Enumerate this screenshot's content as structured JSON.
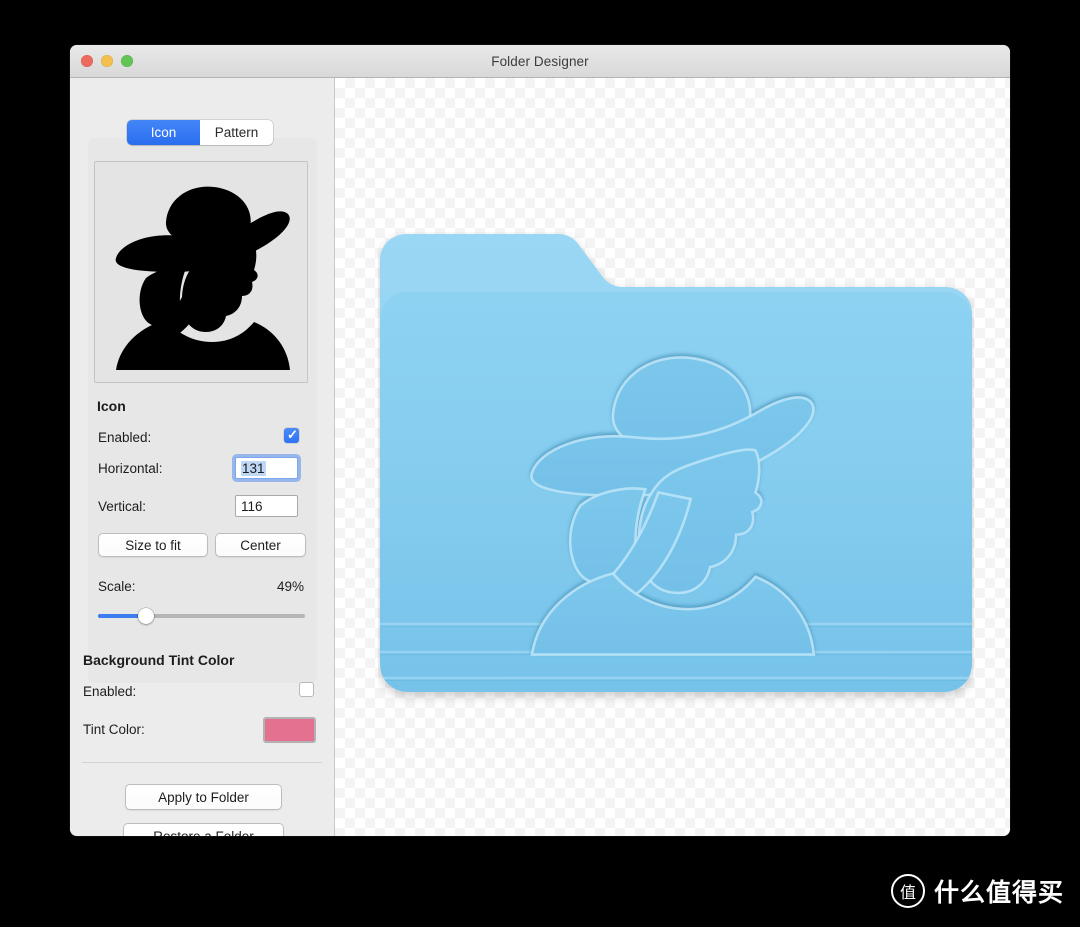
{
  "window": {
    "title": "Folder Designer",
    "traffic_lights": [
      {
        "name": "close",
        "color": "#ed6a5e"
      },
      {
        "name": "minimize",
        "color": "#f5bf4f"
      },
      {
        "name": "maximize",
        "color": "#61c454"
      }
    ]
  },
  "sidebar": {
    "segmented_control": {
      "options": [
        "Icon",
        "Pattern"
      ],
      "selected": "Icon",
      "selected_color": "#3478f6"
    },
    "icon_preview": {
      "name": "woman-with-hat-silhouette",
      "fill": "#000000"
    },
    "icon_section": {
      "heading": "Icon",
      "enabled_label": "Enabled:",
      "enabled_checked": true,
      "horizontal_label": "Horizontal:",
      "horizontal_value": "131",
      "horizontal_focused": true,
      "vertical_label": "Vertical:",
      "vertical_value": "116",
      "size_to_fit_label": "Size to fit",
      "center_label": "Center",
      "scale_label": "Scale:",
      "scale_value": "49%",
      "scale_percent": 23
    },
    "tint_section": {
      "heading": "Background Tint Color",
      "enabled_label": "Enabled:",
      "enabled_checked": false,
      "tint_label": "Tint Color:",
      "tint_color": "#e4718f"
    },
    "actions": {
      "apply_label": "Apply to Folder",
      "restore_label": "Restore a Folder"
    }
  },
  "canvas": {
    "preview_name": "macos-folder-preview",
    "folder_tab_color": "#92d3f2",
    "folder_body_color": "#7fc9ec",
    "folder_icon_color": "#8ed2f2",
    "background": "transparency-checkerboard"
  },
  "watermark": {
    "logo_glyph": "值",
    "text": "什么值得买"
  }
}
